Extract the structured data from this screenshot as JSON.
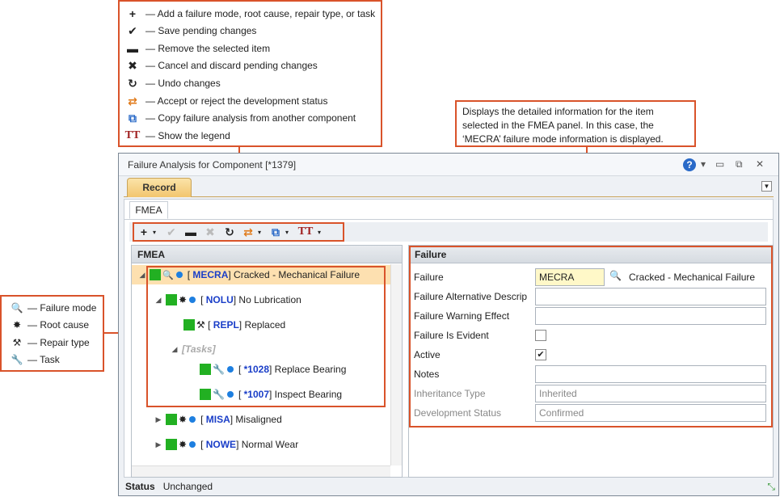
{
  "toolbar_legend": [
    {
      "icon": "plus-icon",
      "glyph": "+",
      "text": "— Add a failure mode, root cause, repair type, or task"
    },
    {
      "icon": "check-icon",
      "glyph": "✔",
      "text": "— Save pending changes"
    },
    {
      "icon": "minus-icon",
      "glyph": "▬",
      "text": "— Remove the selected item"
    },
    {
      "icon": "x-icon",
      "glyph": "✖",
      "text": "— Cancel and discard pending changes"
    },
    {
      "icon": "undo-icon",
      "glyph": "↻",
      "text": "— Undo changes"
    },
    {
      "icon": "accept-reject-icon",
      "glyph": "⇄",
      "text": "— Accept or reject the development status"
    },
    {
      "icon": "copy-analysis-icon",
      "glyph": "⧉",
      "text": "— Copy failure analysis from another component"
    },
    {
      "icon": "legend-icon",
      "glyph": "TT",
      "text": "— Show the legend"
    }
  ],
  "detail_callout": "Displays the detailed information for the item selected in the FMEA panel. In this case, the ‘MECRA’ failure mode information is displayed.",
  "tree_legend": [
    {
      "icon": "failure-mode-icon",
      "text": "— Failure mode"
    },
    {
      "icon": "root-cause-icon",
      "text": "— Root cause"
    },
    {
      "icon": "repair-type-icon",
      "text": "— Repair type"
    },
    {
      "icon": "task-icon",
      "text": "— Task"
    }
  ],
  "window": {
    "title": "Failure Analysis for Component [*1379]",
    "help": "?"
  },
  "tabs": {
    "record": "Record",
    "fmea": "FMEA"
  },
  "fmea_panel": {
    "title": "FMEA",
    "rows": [
      {
        "code": "MECRA",
        "desc": "Cracked - Mechanical Failure"
      },
      {
        "code": "NOLU",
        "desc": "No Lubrication"
      },
      {
        "code": "REPL",
        "desc": "Replaced"
      },
      {
        "group": "[Tasks]"
      },
      {
        "code": "*1028",
        "desc": "Replace Bearing"
      },
      {
        "code": "*1007",
        "desc": "Inspect Bearing"
      },
      {
        "code": "MISA",
        "desc": "Misaligned"
      },
      {
        "code": "NOWE",
        "desc": "Normal Wear"
      }
    ]
  },
  "failure_panel": {
    "title": "Failure",
    "fields": [
      {
        "label": "Failure",
        "value": "MECRA",
        "desc": "Cracked - Mechanical Failure"
      },
      {
        "label": "Failure Alternative Descrip",
        "value": ""
      },
      {
        "label": "Failure Warning Effect",
        "value": ""
      },
      {
        "label": "Failure Is Evident",
        "checked": false
      },
      {
        "label": "Active",
        "checked": true
      },
      {
        "label": "Notes",
        "value": ""
      },
      {
        "label": "Inheritance Type",
        "value": "Inherited"
      },
      {
        "label": "Development Status",
        "value": "Confirmed"
      }
    ]
  },
  "status": {
    "label": "Status",
    "value": "Unchanged"
  }
}
